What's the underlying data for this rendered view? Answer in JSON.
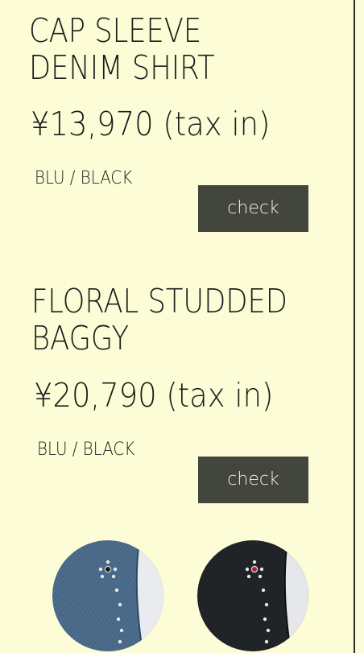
{
  "products": [
    {
      "name_line1": "CAP SLEEVE",
      "name_line2": "DENIM SHIRT",
      "price": "¥13,970 (tax in)",
      "colors": "BLU / BLACK",
      "check_label": "check"
    },
    {
      "name_line1": "FLORAL STUDDED",
      "name_line2": "BAGGY",
      "price": "¥20,790 (tax in)",
      "colors": "BLU / BLACK",
      "check_label": "check"
    }
  ],
  "swatches": [
    {
      "name": "blue-denim-swatch",
      "color": "#4a6a8a"
    },
    {
      "name": "black-denim-swatch",
      "color": "#1e2226"
    }
  ]
}
